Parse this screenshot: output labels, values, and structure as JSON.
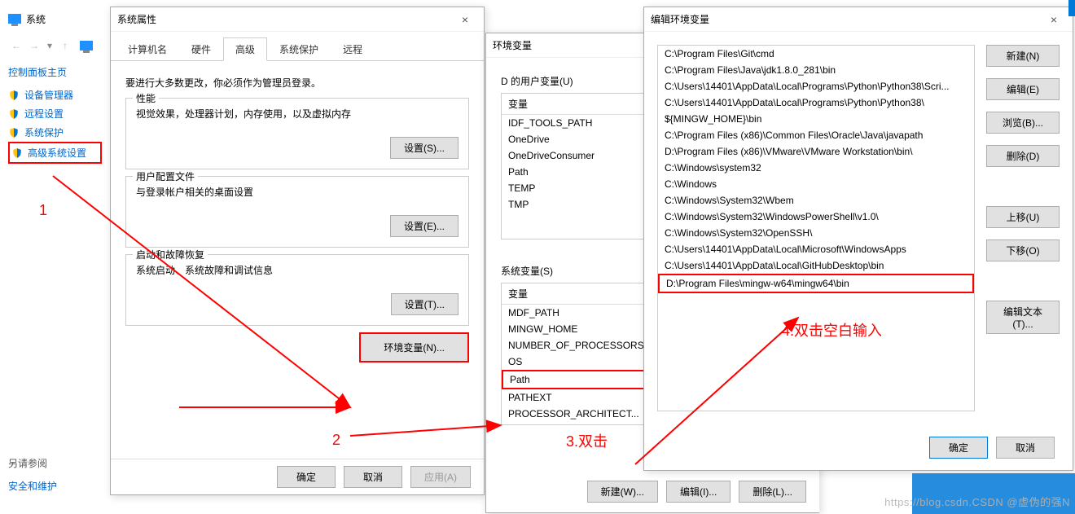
{
  "sidebar": {
    "window_label": "系统",
    "home": "控制面板主页",
    "items": [
      "设备管理器",
      "远程设置",
      "系统保护",
      "高级系统设置"
    ],
    "see_also": "另请参阅",
    "see_items": [
      "安全和维护"
    ]
  },
  "sysprops": {
    "title": "系统属性",
    "tabs": [
      "计算机名",
      "硬件",
      "高级",
      "系统保护",
      "远程"
    ],
    "intro": "要进行大多数更改，你必须作为管理员登录。",
    "perf": {
      "title": "性能",
      "desc": "视觉效果，处理器计划，内存使用，以及虚拟内存",
      "btn": "设置(S)..."
    },
    "profile": {
      "title": "用户配置文件",
      "desc": "与登录帐户相关的桌面设置",
      "btn": "设置(E)..."
    },
    "startup": {
      "title": "启动和故障恢复",
      "desc": "系统启动、系统故障和调试信息",
      "btn": "设置(T)..."
    },
    "env_btn": "环境变量(N)...",
    "ok": "确定",
    "cancel": "取消",
    "apply": "应用(A)"
  },
  "envvar": {
    "title": "环境变量",
    "user_group": "D 的用户变量(U)",
    "sys_group": "系统变量(S)",
    "col": "变量",
    "user_vars": [
      "IDF_TOOLS_PATH",
      "OneDrive",
      "OneDriveConsumer",
      "Path",
      "TEMP",
      "TMP"
    ],
    "sys_vars": [
      "MDF_PATH",
      "MINGW_HOME",
      "NUMBER_OF_PROCESSORS",
      "OS",
      "Path",
      "PATHEXT",
      "PROCESSOR_ARCHITECT..."
    ],
    "new": "新建(W)...",
    "edit": "编辑(I)...",
    "del": "删除(L)..."
  },
  "editpath": {
    "title": "编辑环境变量",
    "entries": [
      "C:\\Program Files\\Git\\cmd",
      "C:\\Program Files\\Java\\jdk1.8.0_281\\bin",
      "C:\\Users\\14401\\AppData\\Local\\Programs\\Python\\Python38\\Scri...",
      "C:\\Users\\14401\\AppData\\Local\\Programs\\Python\\Python38\\",
      "${MINGW_HOME}\\bin",
      "C:\\Program Files (x86)\\Common Files\\Oracle\\Java\\javapath",
      "D:\\Program Files (x86)\\VMware\\VMware Workstation\\bin\\",
      "C:\\Windows\\system32",
      "C:\\Windows",
      "C:\\Windows\\System32\\Wbem",
      "C:\\Windows\\System32\\WindowsPowerShell\\v1.0\\",
      "C:\\Windows\\System32\\OpenSSH\\",
      "C:\\Users\\14401\\AppData\\Local\\Microsoft\\WindowsApps",
      "C:\\Users\\14401\\AppData\\Local\\GitHubDesktop\\bin",
      "D:\\Program Files\\mingw-w64\\mingw64\\bin"
    ],
    "btns": {
      "new": "新建(N)",
      "edit": "编辑(E)",
      "browse": "浏览(B)...",
      "del": "删除(D)",
      "up": "上移(U)",
      "down": "下移(O)",
      "text": "编辑文本(T)..."
    },
    "ok": "确定",
    "cancel": "取消"
  },
  "annotations": {
    "a1": "1",
    "a2": "2",
    "a3": "3.双击",
    "a4": "4.双击空白输入"
  },
  "watermark": "https://blog.csdn.CSDN @虚伪的强N"
}
